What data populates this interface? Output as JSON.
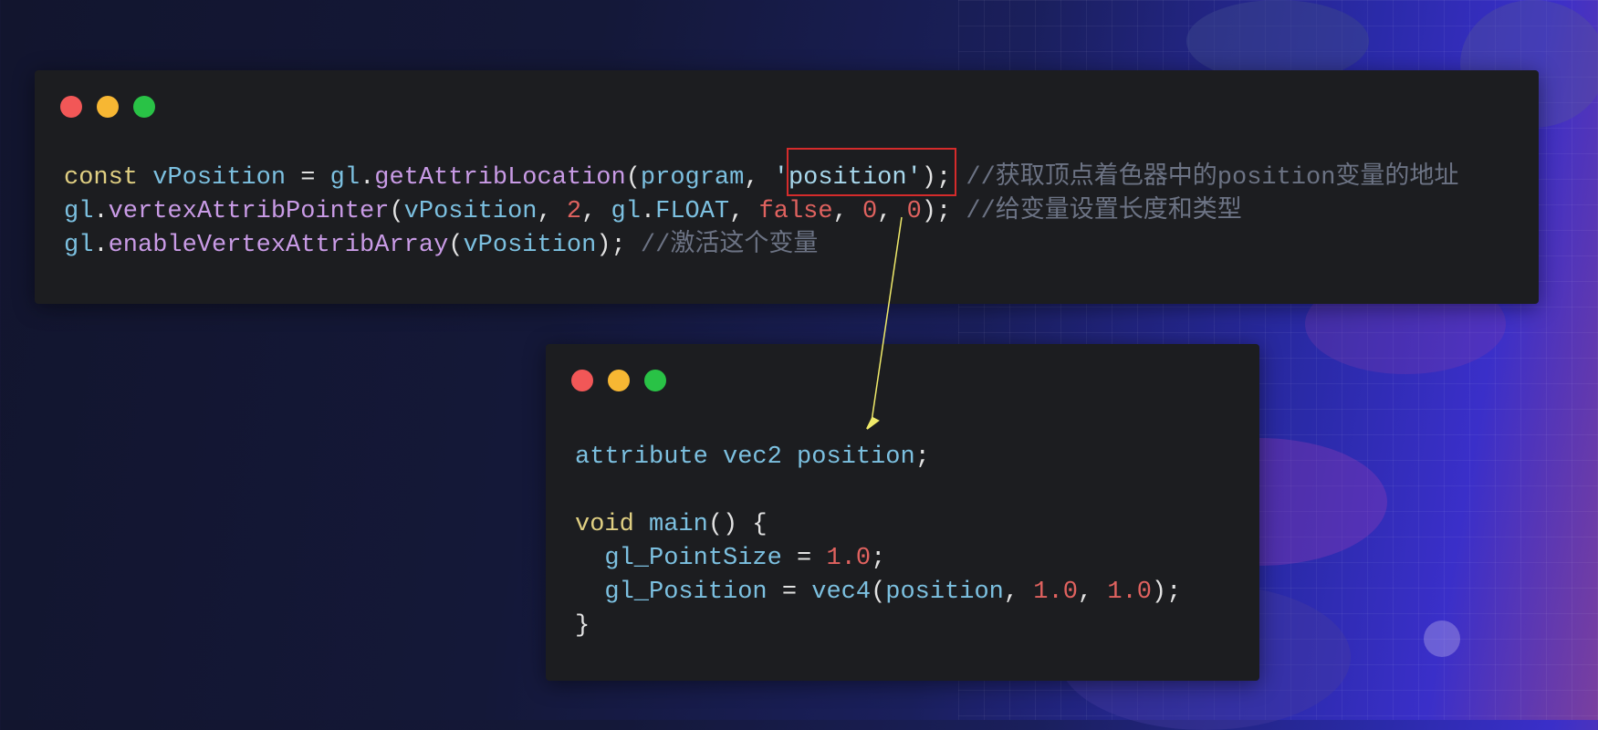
{
  "top_window": {
    "lines": [
      {
        "tokens": [
          {
            "t": "const ",
            "c": "kw"
          },
          {
            "t": "vPosition",
            "c": "var"
          },
          {
            "t": " = ",
            "c": "plain"
          },
          {
            "t": "gl",
            "c": "var"
          },
          {
            "t": ".",
            "c": "plain"
          },
          {
            "t": "getAttribLocation",
            "c": "fn"
          },
          {
            "t": "(",
            "c": "plain"
          },
          {
            "t": "program",
            "c": "var"
          },
          {
            "t": ", ",
            "c": "plain"
          },
          {
            "t": "'position'",
            "c": "str"
          },
          {
            "t": "); ",
            "c": "plain"
          },
          {
            "t": "//获取顶点着色器中的position变量的地址",
            "c": "cm"
          }
        ]
      },
      {
        "tokens": [
          {
            "t": "gl",
            "c": "var"
          },
          {
            "t": ".",
            "c": "plain"
          },
          {
            "t": "vertexAttribPointer",
            "c": "fn"
          },
          {
            "t": "(",
            "c": "plain"
          },
          {
            "t": "vPosition",
            "c": "var"
          },
          {
            "t": ", ",
            "c": "plain"
          },
          {
            "t": "2",
            "c": "num"
          },
          {
            "t": ", ",
            "c": "plain"
          },
          {
            "t": "gl",
            "c": "var"
          },
          {
            "t": ".",
            "c": "plain"
          },
          {
            "t": "FLOAT",
            "c": "var"
          },
          {
            "t": ", ",
            "c": "plain"
          },
          {
            "t": "false",
            "c": "num"
          },
          {
            "t": ", ",
            "c": "plain"
          },
          {
            "t": "0",
            "c": "num"
          },
          {
            "t": ", ",
            "c": "plain"
          },
          {
            "t": "0",
            "c": "num"
          },
          {
            "t": "); ",
            "c": "plain"
          },
          {
            "t": "//给变量设置长度和类型",
            "c": "cm"
          }
        ]
      },
      {
        "tokens": [
          {
            "t": "gl",
            "c": "var"
          },
          {
            "t": ".",
            "c": "plain"
          },
          {
            "t": "enableVertexAttribArray",
            "c": "fn"
          },
          {
            "t": "(",
            "c": "plain"
          },
          {
            "t": "vPosition",
            "c": "var"
          },
          {
            "t": "); ",
            "c": "plain"
          },
          {
            "t": "//激活这个变量",
            "c": "cm"
          }
        ]
      }
    ]
  },
  "bottom_window": {
    "lines": [
      {
        "tokens": [
          {
            "t": "attribute ",
            "c": "var"
          },
          {
            "t": "vec2 ",
            "c": "var"
          },
          {
            "t": "position",
            "c": "var"
          },
          {
            "t": ";",
            "c": "plain"
          }
        ]
      },
      {
        "tokens": [
          {
            "t": " ",
            "c": "plain"
          }
        ]
      },
      {
        "tokens": [
          {
            "t": "void ",
            "c": "kw"
          },
          {
            "t": "main",
            "c": "var"
          },
          {
            "t": "() {",
            "c": "plain"
          }
        ]
      },
      {
        "tokens": [
          {
            "t": "  gl_PointSize",
            "c": "var"
          },
          {
            "t": " = ",
            "c": "plain"
          },
          {
            "t": "1.0",
            "c": "num"
          },
          {
            "t": ";",
            "c": "plain"
          }
        ]
      },
      {
        "tokens": [
          {
            "t": "  gl_Position",
            "c": "var"
          },
          {
            "t": " = ",
            "c": "plain"
          },
          {
            "t": "vec4",
            "c": "var"
          },
          {
            "t": "(",
            "c": "plain"
          },
          {
            "t": "position",
            "c": "var"
          },
          {
            "t": ", ",
            "c": "plain"
          },
          {
            "t": "1.0",
            "c": "num"
          },
          {
            "t": ", ",
            "c": "plain"
          },
          {
            "t": "1.0",
            "c": "num"
          },
          {
            "t": ");",
            "c": "plain"
          }
        ]
      },
      {
        "tokens": [
          {
            "t": "}",
            "c": "plain"
          }
        ]
      }
    ]
  },
  "colors": {
    "dot_red": "#f25757",
    "dot_yellow": "#f7b733",
    "dot_green": "#29c246",
    "highlight_box": "#d52b2b",
    "arrow": "#f0ea6a"
  }
}
